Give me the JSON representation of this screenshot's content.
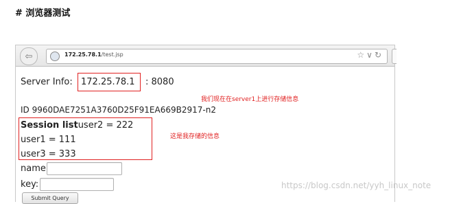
{
  "heading": "# 浏览器测试",
  "browser": {
    "url_host": "172.25.78.1",
    "url_path": "/test.jsp",
    "icons": [
      "back-arrow-icon",
      "globe-icon",
      "star-icon",
      "dropdown-icon",
      "reload-icon"
    ]
  },
  "page": {
    "server_info_label": "Server Info:",
    "server_ip": "172.25.78.1",
    "server_port": ": 8080",
    "session_id": "ID  9960DAE7251A3760D25F91EA669B2917-n2",
    "session_list_label": "Session list",
    "session_list_first": "user2 = 222",
    "session_row_2": "user1 = 111",
    "session_row_3": "user3 = 333",
    "name_label": "name:",
    "key_label": "key:",
    "submit_label": "Submit Query"
  },
  "annotations": {
    "note_server": "我们现在在server1上进行存储信息",
    "note_storage": "这是我存储的信息"
  },
  "watermark": "https://blog.csdn.net/yyh_linux_note",
  "colors": {
    "annotation_red": "#e02020"
  }
}
